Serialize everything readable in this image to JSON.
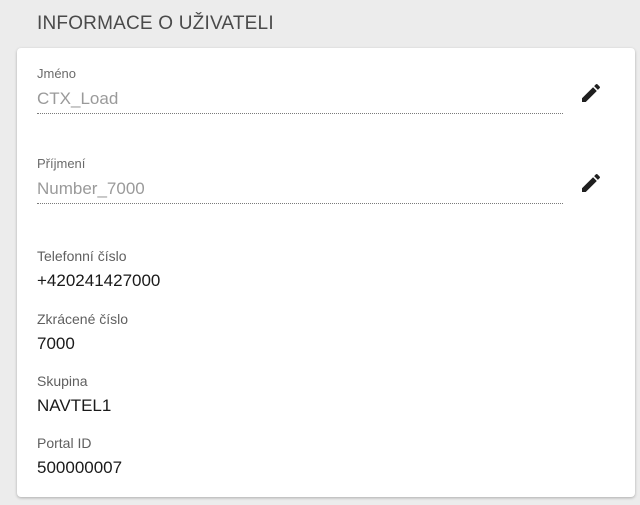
{
  "section": {
    "title": "INFORMACE O UŽIVATELI"
  },
  "fields": {
    "first_name": {
      "label": "Jméno",
      "value": "CTX_Load",
      "icon": "pencil-icon"
    },
    "last_name": {
      "label": "Příjmení",
      "value": "Number_7000",
      "icon": "pencil-icon"
    }
  },
  "info": {
    "phone": {
      "label": "Telefonní číslo",
      "value": "+420241427000"
    },
    "short_number": {
      "label": "Zkrácené číslo",
      "value": "7000"
    },
    "group": {
      "label": "Skupina",
      "value": "NAVTEL1"
    },
    "portal_id": {
      "label": "Portal ID",
      "value": "500000007"
    }
  },
  "colors": {
    "background": "#ececec",
    "card": "#ffffff",
    "icon": "#1f1f1f"
  }
}
